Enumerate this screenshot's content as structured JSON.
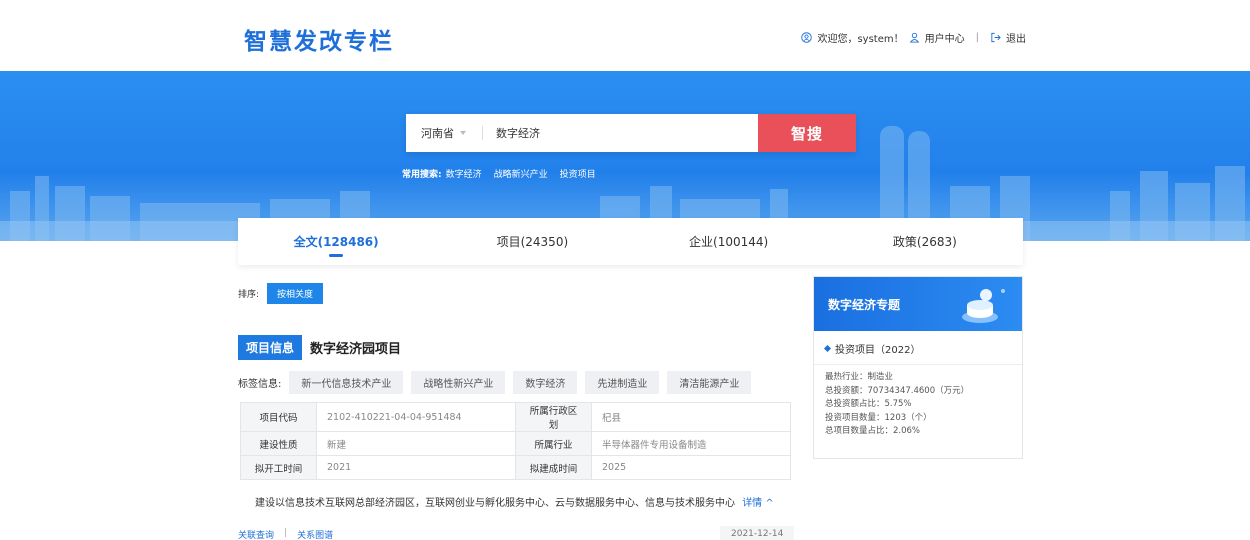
{
  "header": {
    "logo": "智慧发改专栏",
    "welcome": "欢迎您，system！",
    "user_center": "用户中心",
    "logout": "退出"
  },
  "search": {
    "province": "河南省",
    "query": "数字经济",
    "button": "智搜",
    "common_label": "常用搜索:",
    "common_terms": [
      "数字经济",
      "战略新兴产业",
      "投资项目"
    ]
  },
  "tabs": [
    {
      "label": "全文(128486)",
      "active": true
    },
    {
      "label": "项目(24350)",
      "active": false
    },
    {
      "label": "企业(100144)",
      "active": false
    },
    {
      "label": "政策(2683)",
      "active": false
    }
  ],
  "sort": {
    "label": "排序:",
    "option": "按相关度"
  },
  "result": {
    "category": "项目信息",
    "name": "数字经济园项目",
    "labels_title": "标签信息:",
    "labels": [
      "新一代信息技术产业",
      "战略性新兴产业",
      "数字经济",
      "先进制造业",
      "清洁能源产业"
    ],
    "table": [
      [
        {
          "k": "项目代码",
          "v": "2102-410221-04-04-951484"
        },
        {
          "k": "所属行政区划",
          "v": "杞县"
        }
      ],
      [
        {
          "k": "建设性质",
          "v": "新建"
        },
        {
          "k": "所属行业",
          "v": "半导体器件专用设备制造"
        }
      ],
      [
        {
          "k": "拟开工时间",
          "v": "2021"
        },
        {
          "k": "拟建成时间",
          "v": "2025"
        }
      ]
    ],
    "description": "建设以信息技术互联网总部经济园区，互联网创业与孵化服务中心、云与数据服务中心、信息与技术服务中心",
    "more": "详情 ^",
    "related_query": "关联查询",
    "relation_graph": "关系图谱",
    "date": "2021-12-14"
  },
  "topic": {
    "title": "数字经济专题",
    "subtitle": "投资项目（2022）",
    "stats": [
      "最热行业：制造业",
      "总投资额：70734347.4600（万元）",
      "总投资额占比：5.75%",
      "投资项目数量：1203（个）",
      "总项目数量占比：2.06%"
    ]
  },
  "colors": {
    "primary": "#1e6fd9",
    "search_button": "#e9505a"
  }
}
